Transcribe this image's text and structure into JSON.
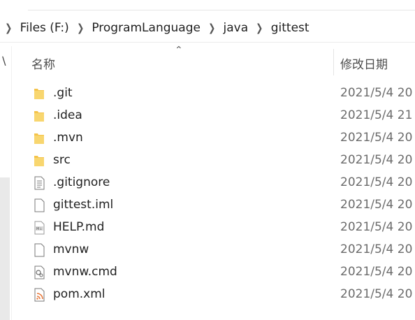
{
  "breadcrumb": {
    "items": [
      "Files (F:)",
      "ProgramLanguage",
      "java",
      "gittest"
    ]
  },
  "columns": {
    "name": "名称",
    "date": "修改日期"
  },
  "files": [
    {
      "name": ".git",
      "date": "2021/5/4 20",
      "icon": "folder-icon"
    },
    {
      "name": ".idea",
      "date": "2021/5/4 21",
      "icon": "folder-icon"
    },
    {
      "name": ".mvn",
      "date": "2021/5/4 20",
      "icon": "folder-icon"
    },
    {
      "name": "src",
      "date": "2021/5/4 20",
      "icon": "folder-icon"
    },
    {
      "name": ".gitignore",
      "date": "2021/5/4 20",
      "icon": "text-file-icon"
    },
    {
      "name": "gittest.iml",
      "date": "2021/5/4 20",
      "icon": "blank-file-icon"
    },
    {
      "name": "HELP.md",
      "date": "2021/5/4 20",
      "icon": "markdown-file-icon"
    },
    {
      "name": "mvnw",
      "date": "2021/5/4 20",
      "icon": "blank-file-icon"
    },
    {
      "name": "mvnw.cmd",
      "date": "2021/5/4 20",
      "icon": "cmd-file-icon"
    },
    {
      "name": "pom.xml",
      "date": "2021/5/4 20",
      "icon": "xml-file-icon"
    }
  ],
  "colors": {
    "folder": "#f4c34a",
    "xml_accent": "#e8783a"
  }
}
